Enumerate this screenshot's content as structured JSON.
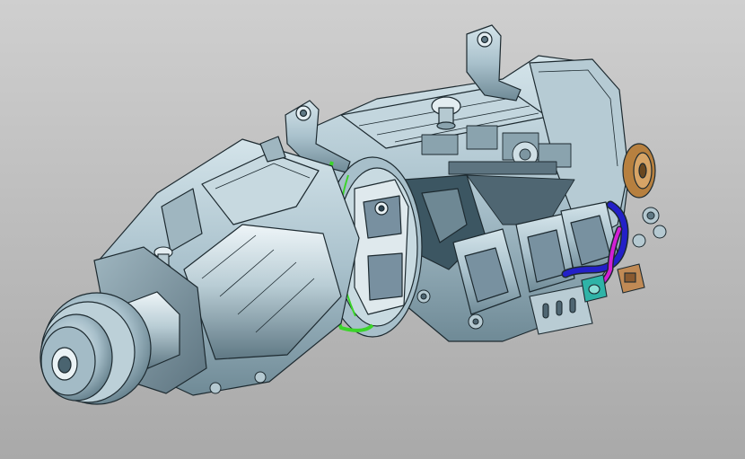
{
  "viewport": {
    "background_top": "#cfcfcf",
    "background_bottom": "#a9a9a9"
  },
  "model": {
    "body_color": "#a9c1cc",
    "body_light": "#d4e4ea",
    "body_shadow": "#6f8a96",
    "edge_color": "#1d2a30",
    "seal_color": "#3bd42a",
    "hose_blue": "#2320c8",
    "hose_magenta": "#d21fd6",
    "fitting_teal": "#2fb3a7",
    "connector_copper": "#c08a55",
    "flange_bronze": "#b7803f"
  }
}
